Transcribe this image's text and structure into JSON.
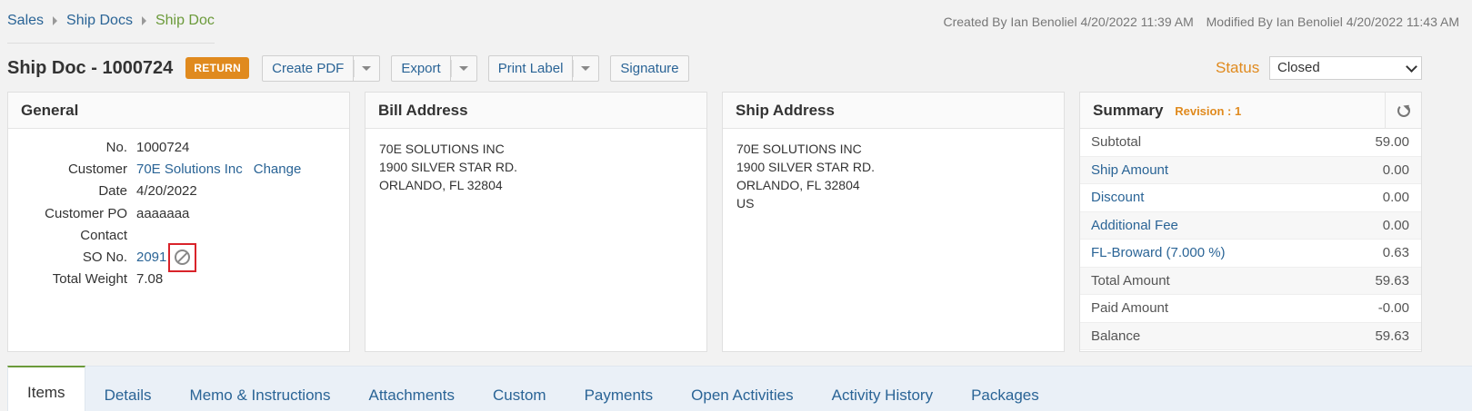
{
  "breadcrumb": [
    "Sales",
    "Ship Docs",
    "Ship Doc"
  ],
  "audit": {
    "created": "Created By Ian Benoliel 4/20/2022 11:39 AM",
    "modified": "Modified By Ian Benoliel 4/20/2022 11:43 AM"
  },
  "title": "Ship Doc - 1000724",
  "badge": "RETURN",
  "toolbar": {
    "create_pdf": "Create PDF",
    "export": "Export",
    "print_label": "Print Label",
    "signature": "Signature"
  },
  "status": {
    "label": "Status",
    "value": "Closed"
  },
  "general": {
    "heading": "General",
    "rows": [
      {
        "label": "No.",
        "value": "1000724"
      },
      {
        "label": "Customer",
        "value": "70E Solutions Inc",
        "action": "Change"
      },
      {
        "label": "Date",
        "value": "4/20/2022"
      },
      {
        "label": "Customer PO",
        "value": "aaaaaaa"
      },
      {
        "label": "Contact",
        "value": ""
      },
      {
        "label": "SO No.",
        "value": "2091"
      },
      {
        "label": "Total Weight",
        "value": "7.08"
      }
    ]
  },
  "bill_address": {
    "heading": "Bill Address",
    "lines": [
      "70E SOLUTIONS INC",
      "1900 SILVER STAR RD.",
      "ORLANDO, FL 32804"
    ]
  },
  "ship_address": {
    "heading": "Ship Address",
    "lines": [
      "70E SOLUTIONS INC",
      "1900 SILVER STAR RD.",
      "ORLANDO, FL 32804",
      "US"
    ]
  },
  "summary": {
    "heading": "Summary",
    "revision": "Revision : 1",
    "rows": [
      {
        "label": "Subtotal",
        "value": "59.00"
      },
      {
        "label": "Ship Amount",
        "value": "0.00"
      },
      {
        "label": "Discount",
        "value": "0.00"
      },
      {
        "label": "Additional Fee",
        "value": "0.00"
      },
      {
        "label": "FL-Broward (7.000 %)",
        "value": "0.63"
      },
      {
        "label": "Total Amount",
        "value": "59.63"
      },
      {
        "label": "Paid Amount",
        "value": "-0.00"
      },
      {
        "label": "Balance",
        "value": "59.63"
      }
    ]
  },
  "tabs": [
    "Items",
    "Details",
    "Memo & Instructions",
    "Attachments",
    "Custom",
    "Payments",
    "Open Activities",
    "Activity History",
    "Packages"
  ],
  "icons": {
    "dropdown": "caret-down-icon",
    "status_select": "chevron-down-icon",
    "so_remove": "ban-icon",
    "summary_refresh": "refresh-icon"
  },
  "colors": {
    "accent_orange": "#e08a1e",
    "link_blue": "#2a6496",
    "current_green": "#6b9a3a",
    "highlight_red": "#d9232a"
  }
}
